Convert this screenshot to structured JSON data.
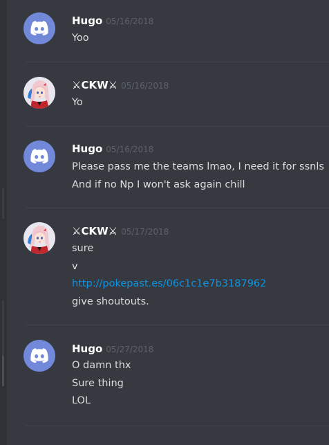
{
  "colors": {
    "background": "#36393f",
    "gutter": "#2f3136",
    "divider": "#42454a",
    "author": "#ffffff",
    "timestamp": "#5e6269",
    "text": "#dcddde",
    "link": "#0b96e6",
    "discord_avatar": "#7289da"
  },
  "messages": [
    {
      "author": "Hugo",
      "timestamp": "05/16/2018",
      "avatar_icon": "discord-logo-icon",
      "lines": [
        "Yoo"
      ]
    },
    {
      "author": "⚔CKW⚔",
      "timestamp": "05/16/2018",
      "avatar_icon": "anime-girl-avatar",
      "lines": [
        "Yo"
      ]
    },
    {
      "author": "Hugo",
      "timestamp": "05/16/2018",
      "avatar_icon": "discord-logo-icon",
      "lines": [
        "Please pass me the teams lmao, I need it for ssnls",
        "And if no Np I won't ask again chill"
      ]
    },
    {
      "author": "⚔CKW⚔",
      "timestamp": "05/17/2018",
      "avatar_icon": "anime-girl-avatar",
      "lines": [
        "sure",
        "v",
        "http://pokepast.es/06c1c1e7b3187962",
        "give shoutouts."
      ]
    },
    {
      "author": "Hugo",
      "timestamp": "05/27/2018",
      "avatar_icon": "discord-logo-icon",
      "lines": [
        "O damn thx",
        "Sure thing",
        "LOL"
      ]
    }
  ]
}
